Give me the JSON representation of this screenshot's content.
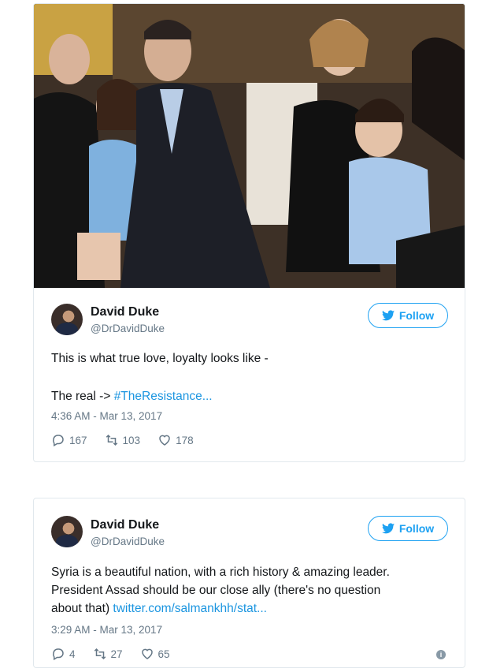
{
  "tweets": [
    {
      "name": "David Duke",
      "handle": "@DrDavidDuke",
      "follow_label": "Follow",
      "line1": "This is what true love, loyalty looks like -",
      "line2_prefix": "The real -> ",
      "line2_link": "#TheResistance...",
      "time": "4:36 AM - Mar 13, 2017",
      "replies": "167",
      "retweets": "103",
      "likes": "178"
    },
    {
      "name": "David Duke",
      "handle": "@DrDavidDuke",
      "follow_label": "Follow",
      "line1": "Syria is a beautiful nation, with a rich history & amazing leader.",
      "line2": "President Assad should be our close ally (there's no question",
      "line3_prefix": "about that) ",
      "line3_link": "twitter.com/salmankhh/stat...",
      "time": "3:29 AM - Mar 13, 2017",
      "replies": "4",
      "retweets": "27",
      "likes": "65"
    }
  ],
  "colors": {
    "accent": "#1da1f2",
    "link": "#1b95e0",
    "muted": "#657786",
    "border": "#e1e8ed"
  },
  "icons": [
    "twitter-bird-icon",
    "reply-icon",
    "retweet-icon",
    "heart-icon",
    "info-icon"
  ]
}
